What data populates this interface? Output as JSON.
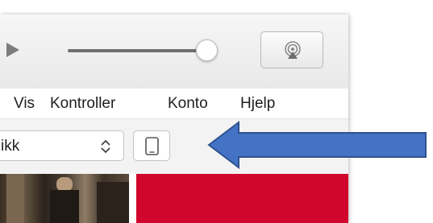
{
  "window": {
    "menu": [
      {
        "label": "Vis"
      },
      {
        "label": "Kontroller"
      },
      {
        "label": "Konto"
      },
      {
        "label": "Hjelp"
      }
    ],
    "player": {
      "play_icon": "play-icon",
      "volume_level": 0.93,
      "airplay_icon": "airplay-icon"
    },
    "toolbar": {
      "category_value": "ikk",
      "category_icon": "chevron-updown-icon",
      "device_icon": "device-icon"
    },
    "content": {
      "right_thumbnail_color": "#d1062c"
    }
  },
  "annotation": {
    "arrow_icon": "arrow-left-icon",
    "arrow_color": "#4472c4"
  },
  "colors": {
    "player_bar": "#ececec",
    "toolbar": "#f3f3f3",
    "icon_gray": "#7c7c7c"
  }
}
